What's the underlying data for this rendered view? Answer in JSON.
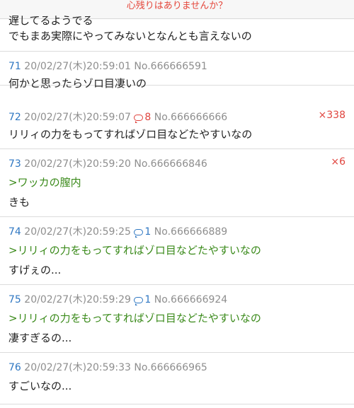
{
  "top_notice": "心残りはありませんか？",
  "partial_post": {
    "cut_text": "遅してるようでる",
    "line": "でもまあ実際にやってみないとなんとも言えないの"
  },
  "posts": [
    {
      "num": "71",
      "date": "20/02/27(木)20:59:01",
      "no": "No.666666591",
      "reply": "",
      "count": "",
      "lines": [
        {
          "text": "何かと思ったらゾロ目凄いの",
          "quote": false
        }
      ]
    },
    {
      "num": "72",
      "date": "20/02/27(木)20:59:07",
      "no": "No.666666666",
      "reply": "8",
      "count": "×338",
      "lines": [
        {
          "text": "リリィの力をもってすればゾロ目などたやすいなの",
          "quote": false
        }
      ]
    },
    {
      "num": "73",
      "date": "20/02/27(木)20:59:20",
      "no": "No.666666846",
      "reply": "",
      "count": "×6",
      "lines": [
        {
          "text": ">ワッカの膣内",
          "quote": true
        },
        {
          "text": "きも",
          "quote": false
        }
      ]
    },
    {
      "num": "74",
      "date": "20/02/27(木)20:59:25",
      "no": "No.666666889",
      "reply": "1",
      "count": "",
      "lines": [
        {
          "text": ">リリィの力をもってすればゾロ目などたやすいなの",
          "quote": true
        },
        {
          "text": "すげぇの...",
          "quote": false
        }
      ]
    },
    {
      "num": "75",
      "date": "20/02/27(木)20:59:29",
      "no": "No.666666924",
      "reply": "1",
      "count": "",
      "lines": [
        {
          "text": ">リリィの力をもってすればゾロ目などたやすいなの",
          "quote": true
        },
        {
          "text": "凄すぎるの...",
          "quote": false
        }
      ]
    },
    {
      "num": "76",
      "date": "20/02/27(木)20:59:33",
      "no": "No.666666965",
      "reply": "",
      "count": "",
      "lines": [
        {
          "text": "すごいなの...",
          "quote": false
        }
      ]
    }
  ],
  "colors": {
    "accent_red": "#e0443e",
    "link_blue": "#2f77c2",
    "quote_green": "#3a8a1a"
  }
}
